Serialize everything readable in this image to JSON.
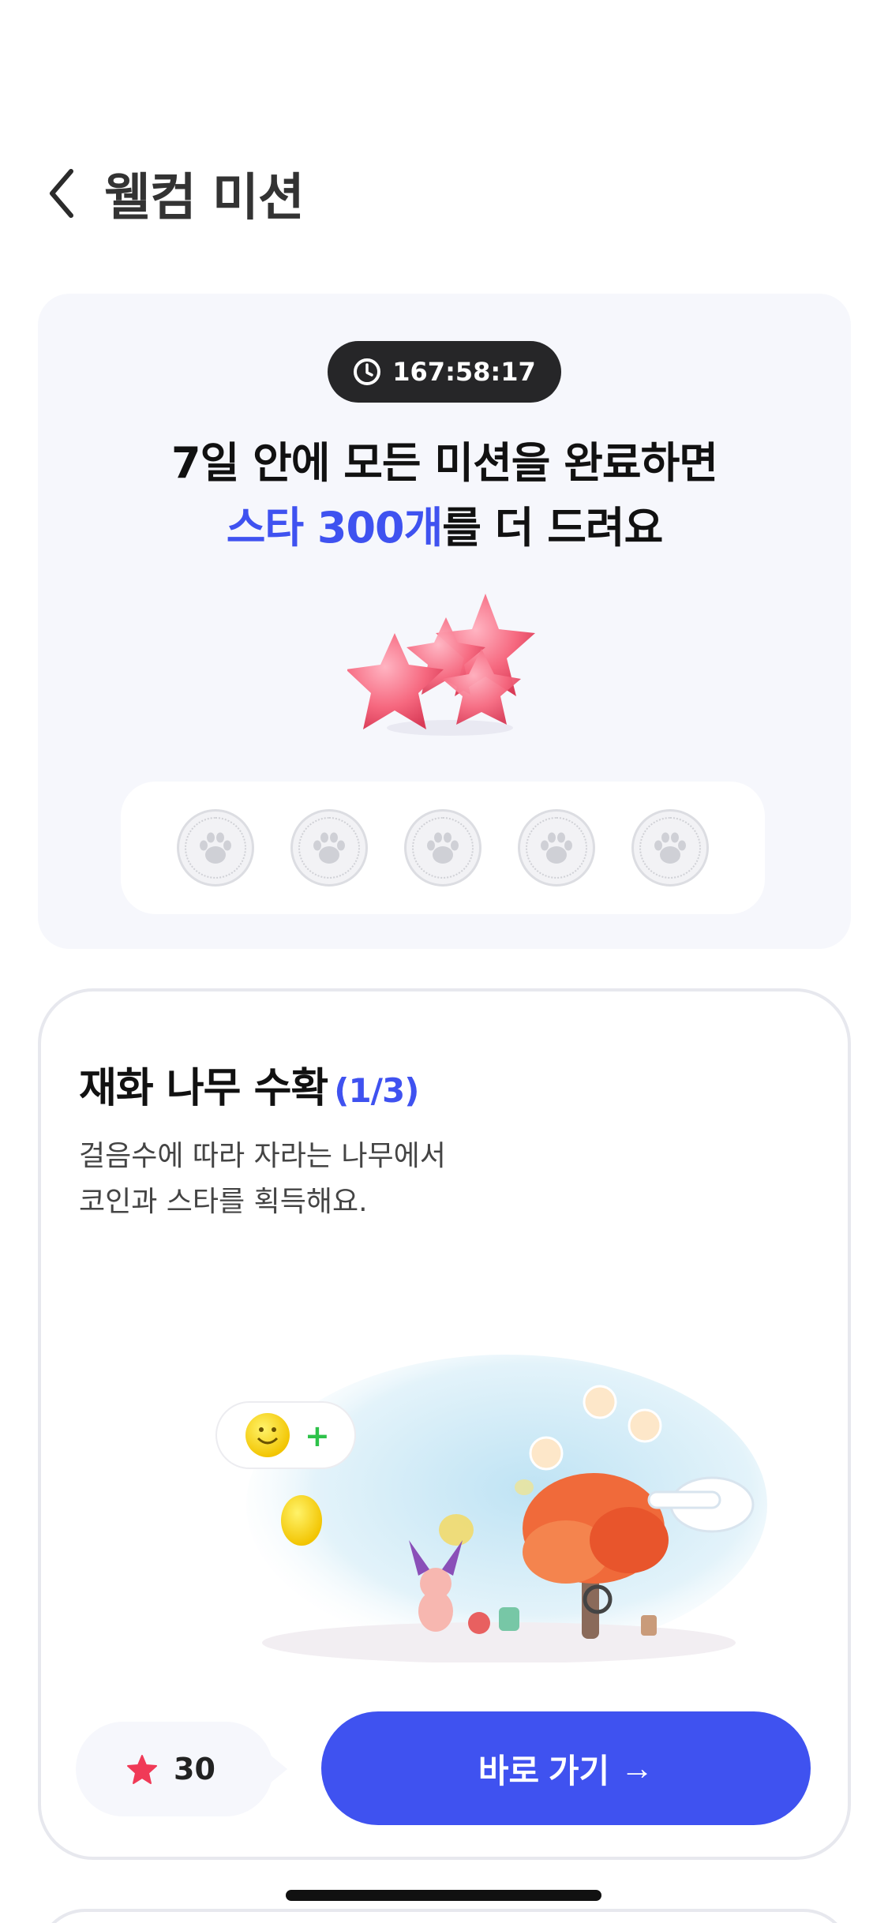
{
  "header": {
    "title": "웰컴 미션"
  },
  "promo": {
    "timer": "167:58:17",
    "line1": "7일 안에 모든 미션을 완료하면",
    "line2_accent": "스타 300개",
    "line2_rest": "를 더 드려요",
    "stamps": [
      {
        "state": "empty",
        "icon": "paw-icon"
      },
      {
        "state": "empty",
        "icon": "paw-icon"
      },
      {
        "state": "empty",
        "icon": "paw-icon"
      },
      {
        "state": "empty",
        "icon": "paw-icon"
      },
      {
        "state": "empty",
        "icon": "paw-icon"
      }
    ]
  },
  "mission": {
    "title": "재화 나무 수확",
    "progress": "(1/3)",
    "desc_line1": "걸음수에 따라 자라는 나무에서",
    "desc_line2": "코인과 스타를 획득해요.",
    "reward_value": "30",
    "go_label": "바로 가기",
    "go_arrow": "→"
  },
  "colors": {
    "accent": "#3f52f0",
    "timer_bg": "#262628",
    "card_bg": "#f6f7fc",
    "star": "#f03a57"
  }
}
